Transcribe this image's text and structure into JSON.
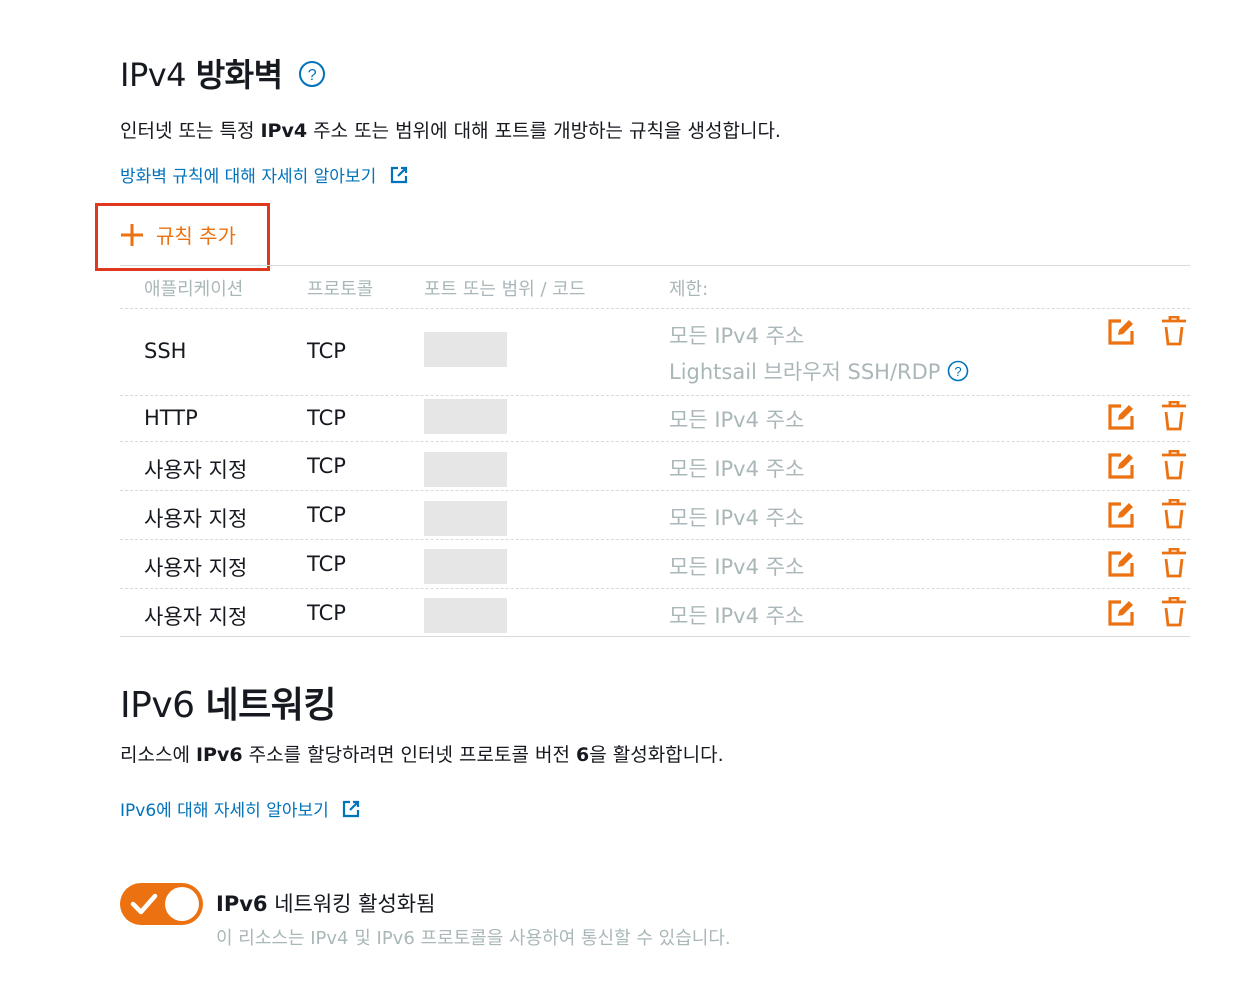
{
  "ipv4": {
    "title_prefix": "IPv4 ",
    "title_strong": "방화벽",
    "description_pre": "인터넷 또는 특정 ",
    "description_bold": "IPv4",
    "description_post": " 주소 또는 범위에 대해 포트를 개방하는 규칙을 생성합니다.",
    "learn_more": "방화벽 규칙에 대해 자세히 알아보기",
    "add_rule": "규칙 추가",
    "columns": [
      "애플리케이션",
      "프로토콜",
      "포트 또는 범위 / 코드",
      "제한:"
    ],
    "rules": [
      {
        "app": "SSH",
        "protocol": "TCP",
        "restriction": "모든 IPv4 주소",
        "restriction_extra": "Lightsail 브라우저 SSH/RDP"
      },
      {
        "app": "HTTP",
        "protocol": "TCP",
        "restriction": "모든 IPv4 주소"
      },
      {
        "app": "사용자 지정",
        "protocol": "TCP",
        "restriction": "모든 IPv4 주소"
      },
      {
        "app": "사용자 지정",
        "protocol": "TCP",
        "restriction": "모든 IPv4 주소"
      },
      {
        "app": "사용자 지정",
        "protocol": "TCP",
        "restriction": "모든 IPv4 주소"
      },
      {
        "app": "사용자 지정",
        "protocol": "TCP",
        "restriction": "모든 IPv4 주소"
      }
    ]
  },
  "ipv6": {
    "title_prefix": "IPv6 ",
    "title_strong": "네트워킹",
    "description_pre": "리소스에 ",
    "description_bold": "IPv6",
    "description_mid": " 주소를 할당하려면 인터넷 프로토콜 버전 ",
    "description_bold2": "6",
    "description_post": "을 활성화합니다.",
    "learn_more": "IPv6에 대해 자세히 알아보기",
    "toggle_label_bold": "IPv6",
    "toggle_label_rest": " 네트워킹 활성화됨",
    "toggle_sub": "이 리소스는 IPv4 및 IPv6 프로토콜을 사용하여 통신할 수 있습니다.",
    "toggle_on": true
  },
  "colors": {
    "accent": "#ec7211",
    "link": "#0073bb",
    "highlight": "#e0371f",
    "muted": "#aab7b8"
  },
  "icons": {
    "help": "help-circle-icon",
    "external": "external-link-icon",
    "add": "plus-icon",
    "edit": "edit-icon",
    "delete": "trash-icon",
    "check": "check-icon"
  }
}
